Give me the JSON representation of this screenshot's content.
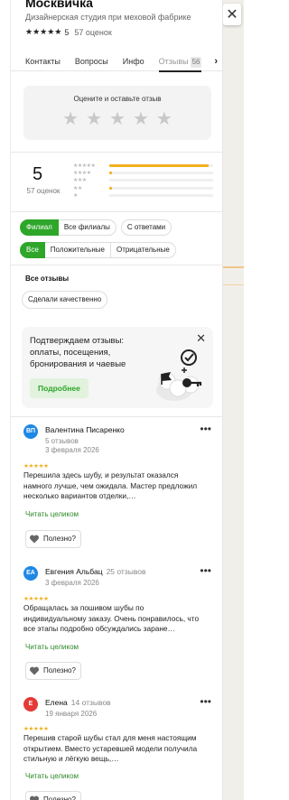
{
  "place": {
    "title": "Москвичка",
    "subtitle": "Дизайнерская студия при меховой фабрике",
    "stars": "★★★★★",
    "rating": "5",
    "reviews_count": "57 оценок"
  },
  "tabs": [
    {
      "label": "Контакты"
    },
    {
      "label": "Вопросы"
    },
    {
      "label": "Инфо"
    },
    {
      "label": "Отзывы",
      "badge": "56"
    }
  ],
  "rate_prompt": {
    "text": "Оцените и оставьте отзыв",
    "stars": [
      "★",
      "★",
      "★",
      "★",
      "★"
    ]
  },
  "summary": {
    "score": "5",
    "count": "57 оценок",
    "distribution": [
      {
        "stars": "★★★★★",
        "share": 0.96
      },
      {
        "stars": "★★★★",
        "share": 0.02
      },
      {
        "stars": "★★★",
        "share": 0.0
      },
      {
        "stars": "★★",
        "share": 0.02
      },
      {
        "stars": "★",
        "share": 0.0
      }
    ]
  },
  "filters": {
    "scope": [
      "Филиал",
      "Все филиалы"
    ],
    "with_answers": "С ответами",
    "sentiment": [
      "Все",
      "Положительные",
      "Отрицательные"
    ]
  },
  "all_reviews_label": "Все отзывы",
  "quality_pill": "Сделали качественно",
  "promo": {
    "text": "Подтверждаем отзывы: оплаты, посещения, бронирования и чаевые",
    "button": "Подробнее",
    "close": "✕"
  },
  "reviews": [
    {
      "initials": "ВП",
      "avatar_color": "#1e88e5",
      "name": "Валентина Писаренко",
      "count": "",
      "count_line": "5 отзывов",
      "date": "3 февраля 2026",
      "stars": "★★★★★",
      "text": "Перешила здесь шубу, и результат оказался намного лучше, чем ожидала. Мастер предложил несколько вариантов отделки,…",
      "read_more": "Читать целиком",
      "useful": "Полезно?"
    },
    {
      "initials": "ЕА",
      "avatar_color": "#1e88e5",
      "name": "Евгения Альбац",
      "count": "25 отзывов",
      "count_line": "",
      "date": "3 февраля 2026",
      "stars": "★★★★★",
      "text": "Обращалась за пошивом шубы по индивидуальному заказу. Очень понравилось, что все этапы подробно обсуждались заране…",
      "read_more": "Читать целиком",
      "useful": "Полезно?"
    },
    {
      "initials": "Е",
      "avatar_color": "#e53935",
      "name": "Елена",
      "count": "14 отзывов",
      "count_line": "",
      "date": "19 января 2026",
      "stars": "★★★★★",
      "text": "Перешив старой шубы стал для меня настоящим открытием. Вместо устаревшей модели получила стильную и лёгкую вещь,…",
      "read_more": "Читать целиком",
      "useful": "Полезно?"
    }
  ],
  "map": {
    "close": "✕"
  }
}
